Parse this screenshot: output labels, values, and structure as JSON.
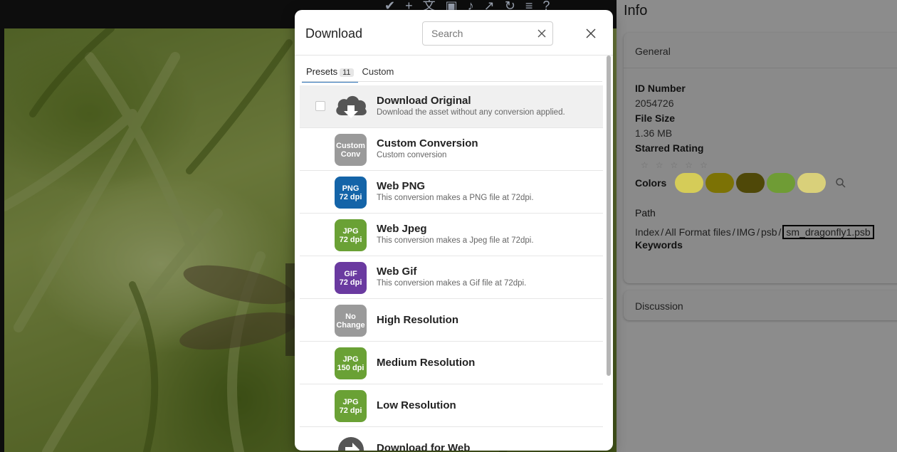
{
  "info": {
    "title": "Info",
    "general": {
      "header": "General",
      "id_label": "ID Number",
      "id_value": "2054726",
      "size_label": "File Size",
      "size_value": "1.36 MB",
      "rating_label": "Starred Rating",
      "rating_value": 0,
      "colors_label": "Colors",
      "colors": [
        "#d5cc58",
        "#7c7205",
        "#4f4808",
        "#6f9c35",
        "#d9d07a"
      ],
      "path_label": "Path",
      "path": [
        "Index",
        "All Format files",
        "IMG",
        "psb"
      ],
      "path_current": "sm_dragonfly1.psb",
      "keywords_label": "Keywords"
    },
    "discussion_header": "Discussion"
  },
  "modal": {
    "title": "Download",
    "search_placeholder": "Search",
    "tabs": {
      "presets_label": "Presets",
      "presets_count": "11",
      "custom_label": "Custom"
    },
    "items": [
      {
        "title": "Download Original",
        "desc": "Download the asset without any conversion applied.",
        "icon": "cloud-download-icon"
      },
      {
        "title": "Custom Conversion",
        "desc": "Custom conversion",
        "badge_l1": "Custom",
        "badge_l2": "Conv",
        "color": "#9a9a9a"
      },
      {
        "title": "Web PNG",
        "desc": "This conversion makes a PNG file at 72dpi.",
        "badge_l1": "PNG",
        "badge_l2": "72 dpi",
        "color": "#1464a8"
      },
      {
        "title": "Web Jpeg",
        "desc": "This conversion makes a Jpeg file at 72dpi.",
        "badge_l1": "JPG",
        "badge_l2": "72 dpi",
        "color": "#6aa135"
      },
      {
        "title": "Web Gif",
        "desc": "This conversion makes a Gif file at 72dpi.",
        "badge_l1": "GIF",
        "badge_l2": "72 dpi",
        "color": "#6a3aa0"
      },
      {
        "title": "High Resolution",
        "badge_l1": "No",
        "badge_l2": "Change",
        "color": "#9a9a9a"
      },
      {
        "title": "Medium Resolution",
        "badge_l1": "JPG",
        "badge_l2": "150 dpi",
        "color": "#6aa135"
      },
      {
        "title": "Low Resolution",
        "badge_l1": "JPG",
        "badge_l2": "72 dpi",
        "color": "#6aa135"
      },
      {
        "title": "Download for Web",
        "icon": "globe-download-icon"
      }
    ]
  }
}
